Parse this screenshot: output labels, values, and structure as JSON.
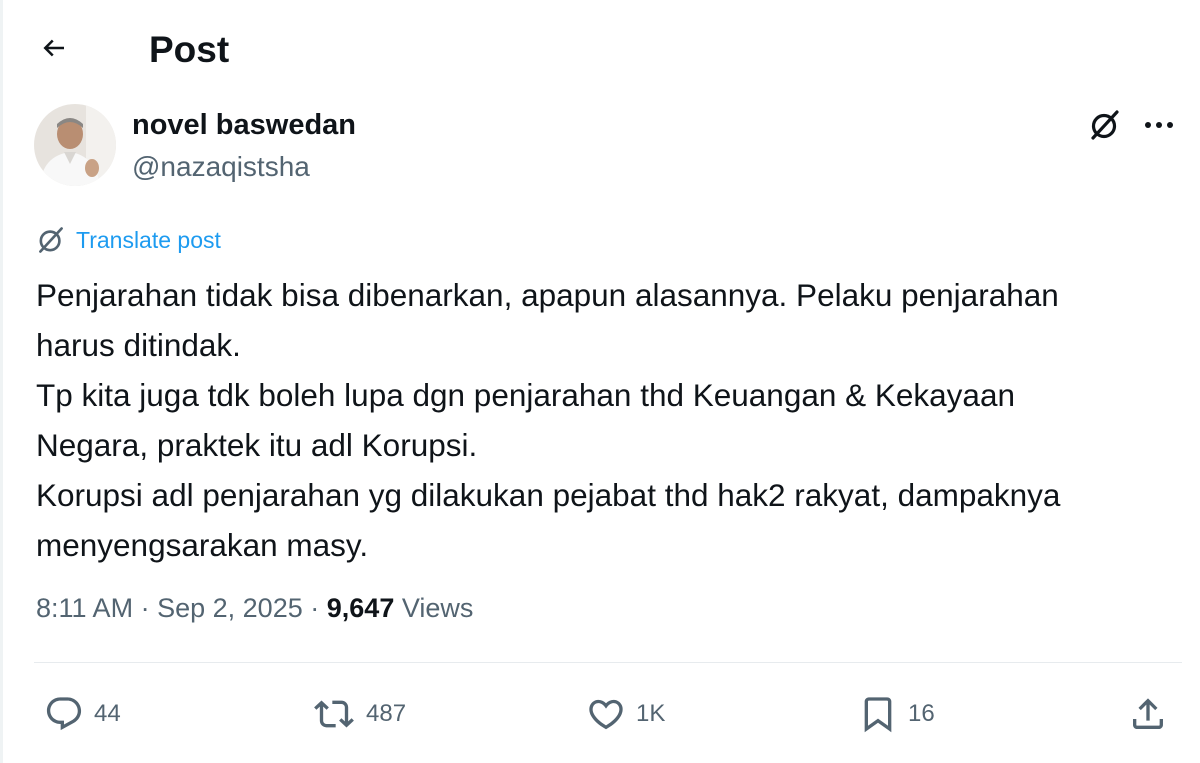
{
  "header": {
    "title": "Post"
  },
  "author": {
    "name": "novel baswedan",
    "handle": "@nazaqistsha"
  },
  "translate": {
    "label": "Translate post"
  },
  "post": {
    "lines": [
      "Penjarahan tidak bisa dibenarkan, apapun alasannya. Pelaku penjarahan",
      "harus ditindak.",
      "Tp kita juga tdk boleh lupa dgn penjarahan thd Keuangan & Kekayaan",
      "Negara, praktek itu adl Korupsi.",
      "Korupsi adl penjarahan yg dilakukan pejabat thd hak2 rakyat, dampaknya",
      "menyengsarakan masy."
    ]
  },
  "meta": {
    "time": "8:11 AM",
    "separator": "·",
    "date": "Sep 2, 2025",
    "views_count": "9,647",
    "views_label": "Views"
  },
  "actions": {
    "replies": "44",
    "reposts": "487",
    "likes": "1K",
    "bookmarks": "16"
  },
  "icons": {
    "back": "arrow-left-icon",
    "grok": "grok-icon",
    "more": "more-horizontal-icon",
    "translate": "grok-icon",
    "reply": "reply-icon",
    "repost": "repost-icon",
    "like": "heart-icon",
    "bookmark": "bookmark-icon",
    "share": "share-icon"
  },
  "colors": {
    "accent": "#1d9bf0",
    "secondary_text": "#536471",
    "primary_text": "#0f1419"
  }
}
